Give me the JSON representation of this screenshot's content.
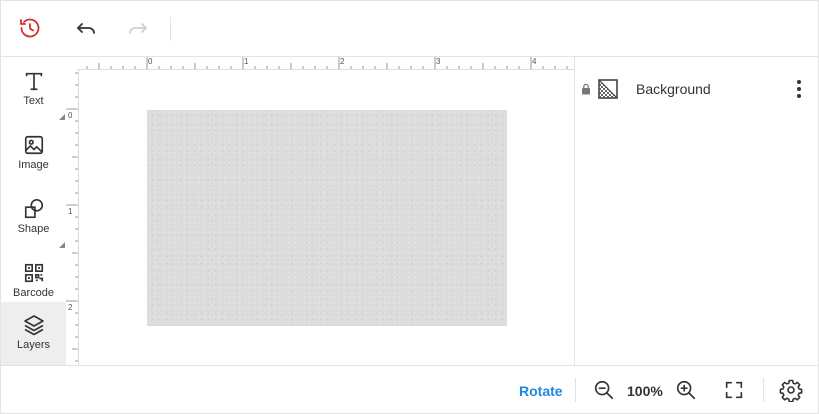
{
  "toolbar": {
    "history_icon": "history-icon",
    "undo_icon": "undo-icon",
    "redo_icon": "redo-icon",
    "history_color": "#d32f2f"
  },
  "sidebar": {
    "items": [
      {
        "label": "Text",
        "icon": "text-icon"
      },
      {
        "label": "Image",
        "icon": "image-icon"
      },
      {
        "label": "Shape",
        "icon": "shape-icon"
      },
      {
        "label": "Barcode",
        "icon": "barcode-icon"
      },
      {
        "label": "Layers",
        "icon": "layers-icon",
        "active": true
      }
    ]
  },
  "rulers": {
    "top_labels": [
      "0",
      "1",
      "2",
      "3",
      "4"
    ],
    "left_labels": [
      "0",
      "1",
      "2"
    ]
  },
  "layers": {
    "items": [
      {
        "name": "Background",
        "locked": true
      }
    ]
  },
  "bottombar": {
    "rotate_label": "Rotate",
    "zoom_value": "100%",
    "accent": "#1e88e5"
  }
}
